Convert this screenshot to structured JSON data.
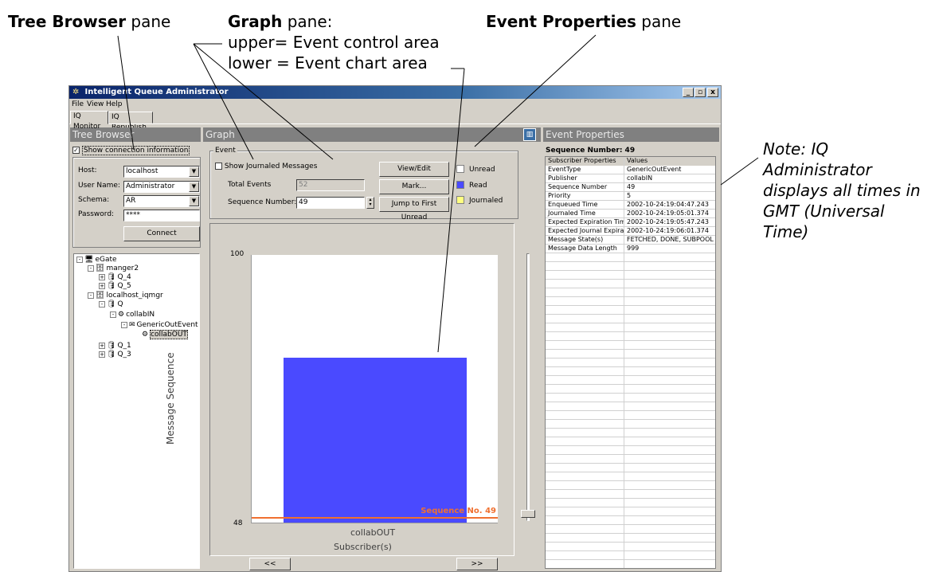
{
  "annotations": {
    "tree_browser": {
      "bold": "Tree Browser",
      "rest": " pane"
    },
    "graph": {
      "bold": "Graph",
      "rest": " pane:",
      "line2": "upper= Event control area",
      "line3": "lower = Event chart area"
    },
    "event_properties": {
      "bold": "Event Properties",
      "rest": " pane"
    },
    "note": "Note: IQ Administrator displays all times in GMT (Universal Time)"
  },
  "window": {
    "title": "Intelligent Queue Administrator",
    "controls": {
      "minimize": "_",
      "maximize": "▫",
      "close": "x"
    },
    "menu": [
      "File",
      "View",
      "Help"
    ],
    "tabs": [
      "IQ Monitor",
      "IQ Republish"
    ]
  },
  "tree_browser": {
    "header": "Tree Browser",
    "show_connection_label": "Show connection information",
    "show_connection_checked": true,
    "host_label": "Host:",
    "host_value": "localhost",
    "username_label": "User Name:",
    "username_value": "Administrator",
    "schema_label": "Schema:",
    "schema_value": "AR",
    "password_label": "Password:",
    "password_value": "****",
    "connect_label": "Connect",
    "tree": [
      {
        "label": "eGate",
        "exp": "-",
        "icon": "🖥"
      },
      {
        "label": "manger2",
        "exp": "-",
        "icon": "🗄"
      },
      {
        "label": "Q_4",
        "exp": "+",
        "icon": "🛢"
      },
      {
        "label": "Q_5",
        "exp": "+",
        "icon": "🛢"
      },
      {
        "label": "localhost_iqmgr",
        "exp": "-",
        "icon": "🗄"
      },
      {
        "label": "Q",
        "exp": "-",
        "icon": "🛢"
      },
      {
        "label": "collabIN",
        "exp": "-",
        "icon": "⚙"
      },
      {
        "label": "GenericOutEvent",
        "exp": "-",
        "icon": "✉"
      },
      {
        "label": "collabOUT",
        "exp": "",
        "icon": "⚙"
      },
      {
        "label": "Q_1",
        "exp": "+",
        "icon": "🛢"
      },
      {
        "label": "Q_3",
        "exp": "+",
        "icon": "🛢"
      }
    ]
  },
  "graph": {
    "header": "Graph",
    "event_group_label": "Event",
    "show_journaled_label": "Show Journaled Messages",
    "show_journaled_checked": false,
    "total_events_label": "Total Events",
    "total_events_value": "52",
    "sequence_number_label": "Sequence Number:",
    "sequence_number_value": "49",
    "view_edit_label": "View/Edit",
    "mark_label": "Mark...",
    "jump_label": "Jump to First Unread",
    "legend": [
      {
        "label": "Unread",
        "color": "#ffffff"
      },
      {
        "label": "Read",
        "color": "#4a4aff"
      },
      {
        "label": "Journaled",
        "color": "#ffff80"
      }
    ],
    "prev_label": "<<",
    "next_label": ">>"
  },
  "chart_data": {
    "type": "bar",
    "categories": [
      "collabOUT"
    ],
    "series": [
      {
        "name": "Read",
        "values": [
          80
        ],
        "color": "#4a4aff"
      },
      {
        "name": "Unread",
        "values": [
          100
        ],
        "color": "#ffffff"
      }
    ],
    "ylim": [
      48,
      100
    ],
    "yticks": [
      "100",
      "48"
    ],
    "ylabel": "Message Sequence",
    "xlabel": "Subscriber(s)",
    "marker_label": "Sequence No. 49",
    "marker_value": 49,
    "marker_color": "#f07030"
  },
  "event_properties": {
    "header": "Event Properties",
    "sequence_title": "Sequence Number: 49",
    "columns": [
      "Subscriber Properties",
      "Values"
    ],
    "rows": [
      [
        "EventType",
        "GenericOutEvent"
      ],
      [
        "Publisher",
        "collabIN"
      ],
      [
        "Sequence Number",
        "49"
      ],
      [
        "Priority",
        "5"
      ],
      [
        "Enqueued Time",
        "2002-10-24:19:04:47.243"
      ],
      [
        "Journaled Time",
        "2002-10-24:19:05:01.374"
      ],
      [
        "Expected Expiration Time",
        "2002-10-24:19:05:47.243"
      ],
      [
        "Expected Journal Expiration",
        "2002-10-24:19:06:01.374"
      ],
      [
        "Message State(s)",
        "FETCHED, DONE, SUBPOOL"
      ],
      [
        "Message Data Length",
        "999"
      ]
    ]
  }
}
